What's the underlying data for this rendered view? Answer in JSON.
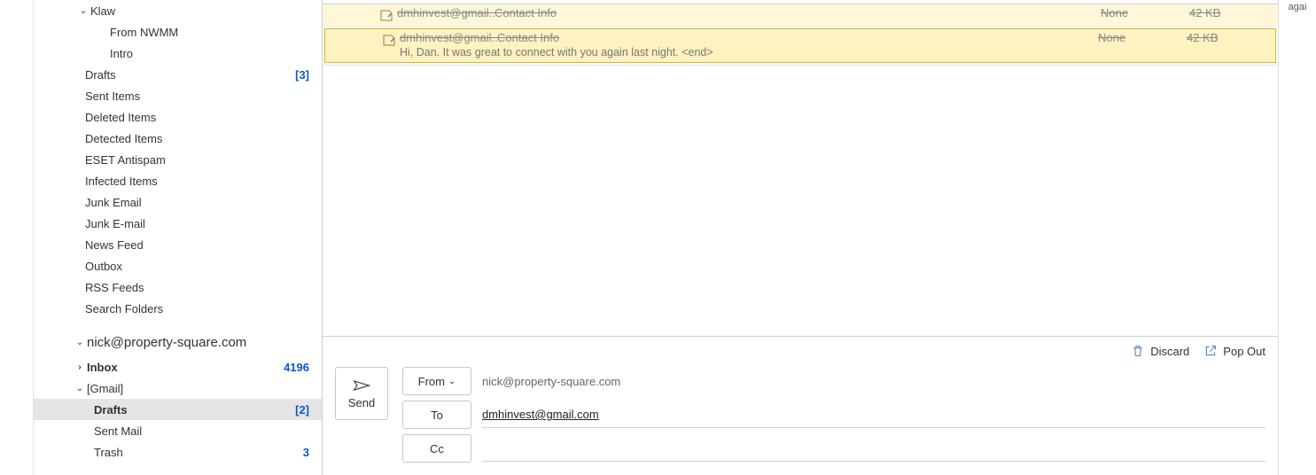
{
  "sidebar": {
    "top_folders": [
      {
        "label": "Klaw",
        "pad": 62,
        "chev": "down"
      },
      {
        "label": "From NWMM",
        "pad": 86
      },
      {
        "label": "Intro",
        "pad": 86
      },
      {
        "label": "Drafts",
        "pad": 58,
        "count": "[3]"
      },
      {
        "label": "Sent Items",
        "pad": 58
      },
      {
        "label": "Deleted Items",
        "pad": 58
      },
      {
        "label": "Detected Items",
        "pad": 58
      },
      {
        "label": "ESET Antispam",
        "pad": 58
      },
      {
        "label": "Infected Items",
        "pad": 58
      },
      {
        "label": "Junk Email",
        "pad": 58
      },
      {
        "label": "Junk E-mail",
        "pad": 58
      },
      {
        "label": "News Feed",
        "pad": 58
      },
      {
        "label": "Outbox",
        "pad": 58
      },
      {
        "label": "RSS Feeds",
        "pad": 58
      },
      {
        "label": "Search Folders",
        "pad": 58
      }
    ],
    "account2": {
      "header": "nick@property-square.com",
      "folders": [
        {
          "label": "Inbox",
          "pad": 58,
          "chev": "right",
          "count": "4196",
          "bold": true,
          "countBold": true
        },
        {
          "label": "[Gmail]",
          "pad": 58,
          "chev": "down"
        },
        {
          "label": "Drafts",
          "pad": 68,
          "count": "[2]",
          "bold": true,
          "selected": true
        },
        {
          "label": "Sent Mail",
          "pad": 68
        },
        {
          "label": "Trash",
          "pad": 68,
          "count": "3",
          "countBold": true
        }
      ]
    }
  },
  "messages": [
    {
      "to": "dmhinvest@gmail....",
      "subject": "Contact Info",
      "sent": "None",
      "size": "42 KB",
      "preview": ""
    },
    {
      "to": "dmhinvest@gmail....",
      "subject": "Contact Info",
      "sent": "None",
      "size": "42 KB",
      "preview": "Hi, Dan.  It was great to connect with you again last night. <end>",
      "selected": true
    }
  ],
  "compose": {
    "discard": "Discard",
    "popout": "Pop Out",
    "send": "Send",
    "from_label": "From",
    "to_label": "To",
    "cc_label": "Cc",
    "from_value": "nick@property-square.com",
    "to_value": "dmhinvest@gmail.com"
  },
  "right_fragment": "agai"
}
